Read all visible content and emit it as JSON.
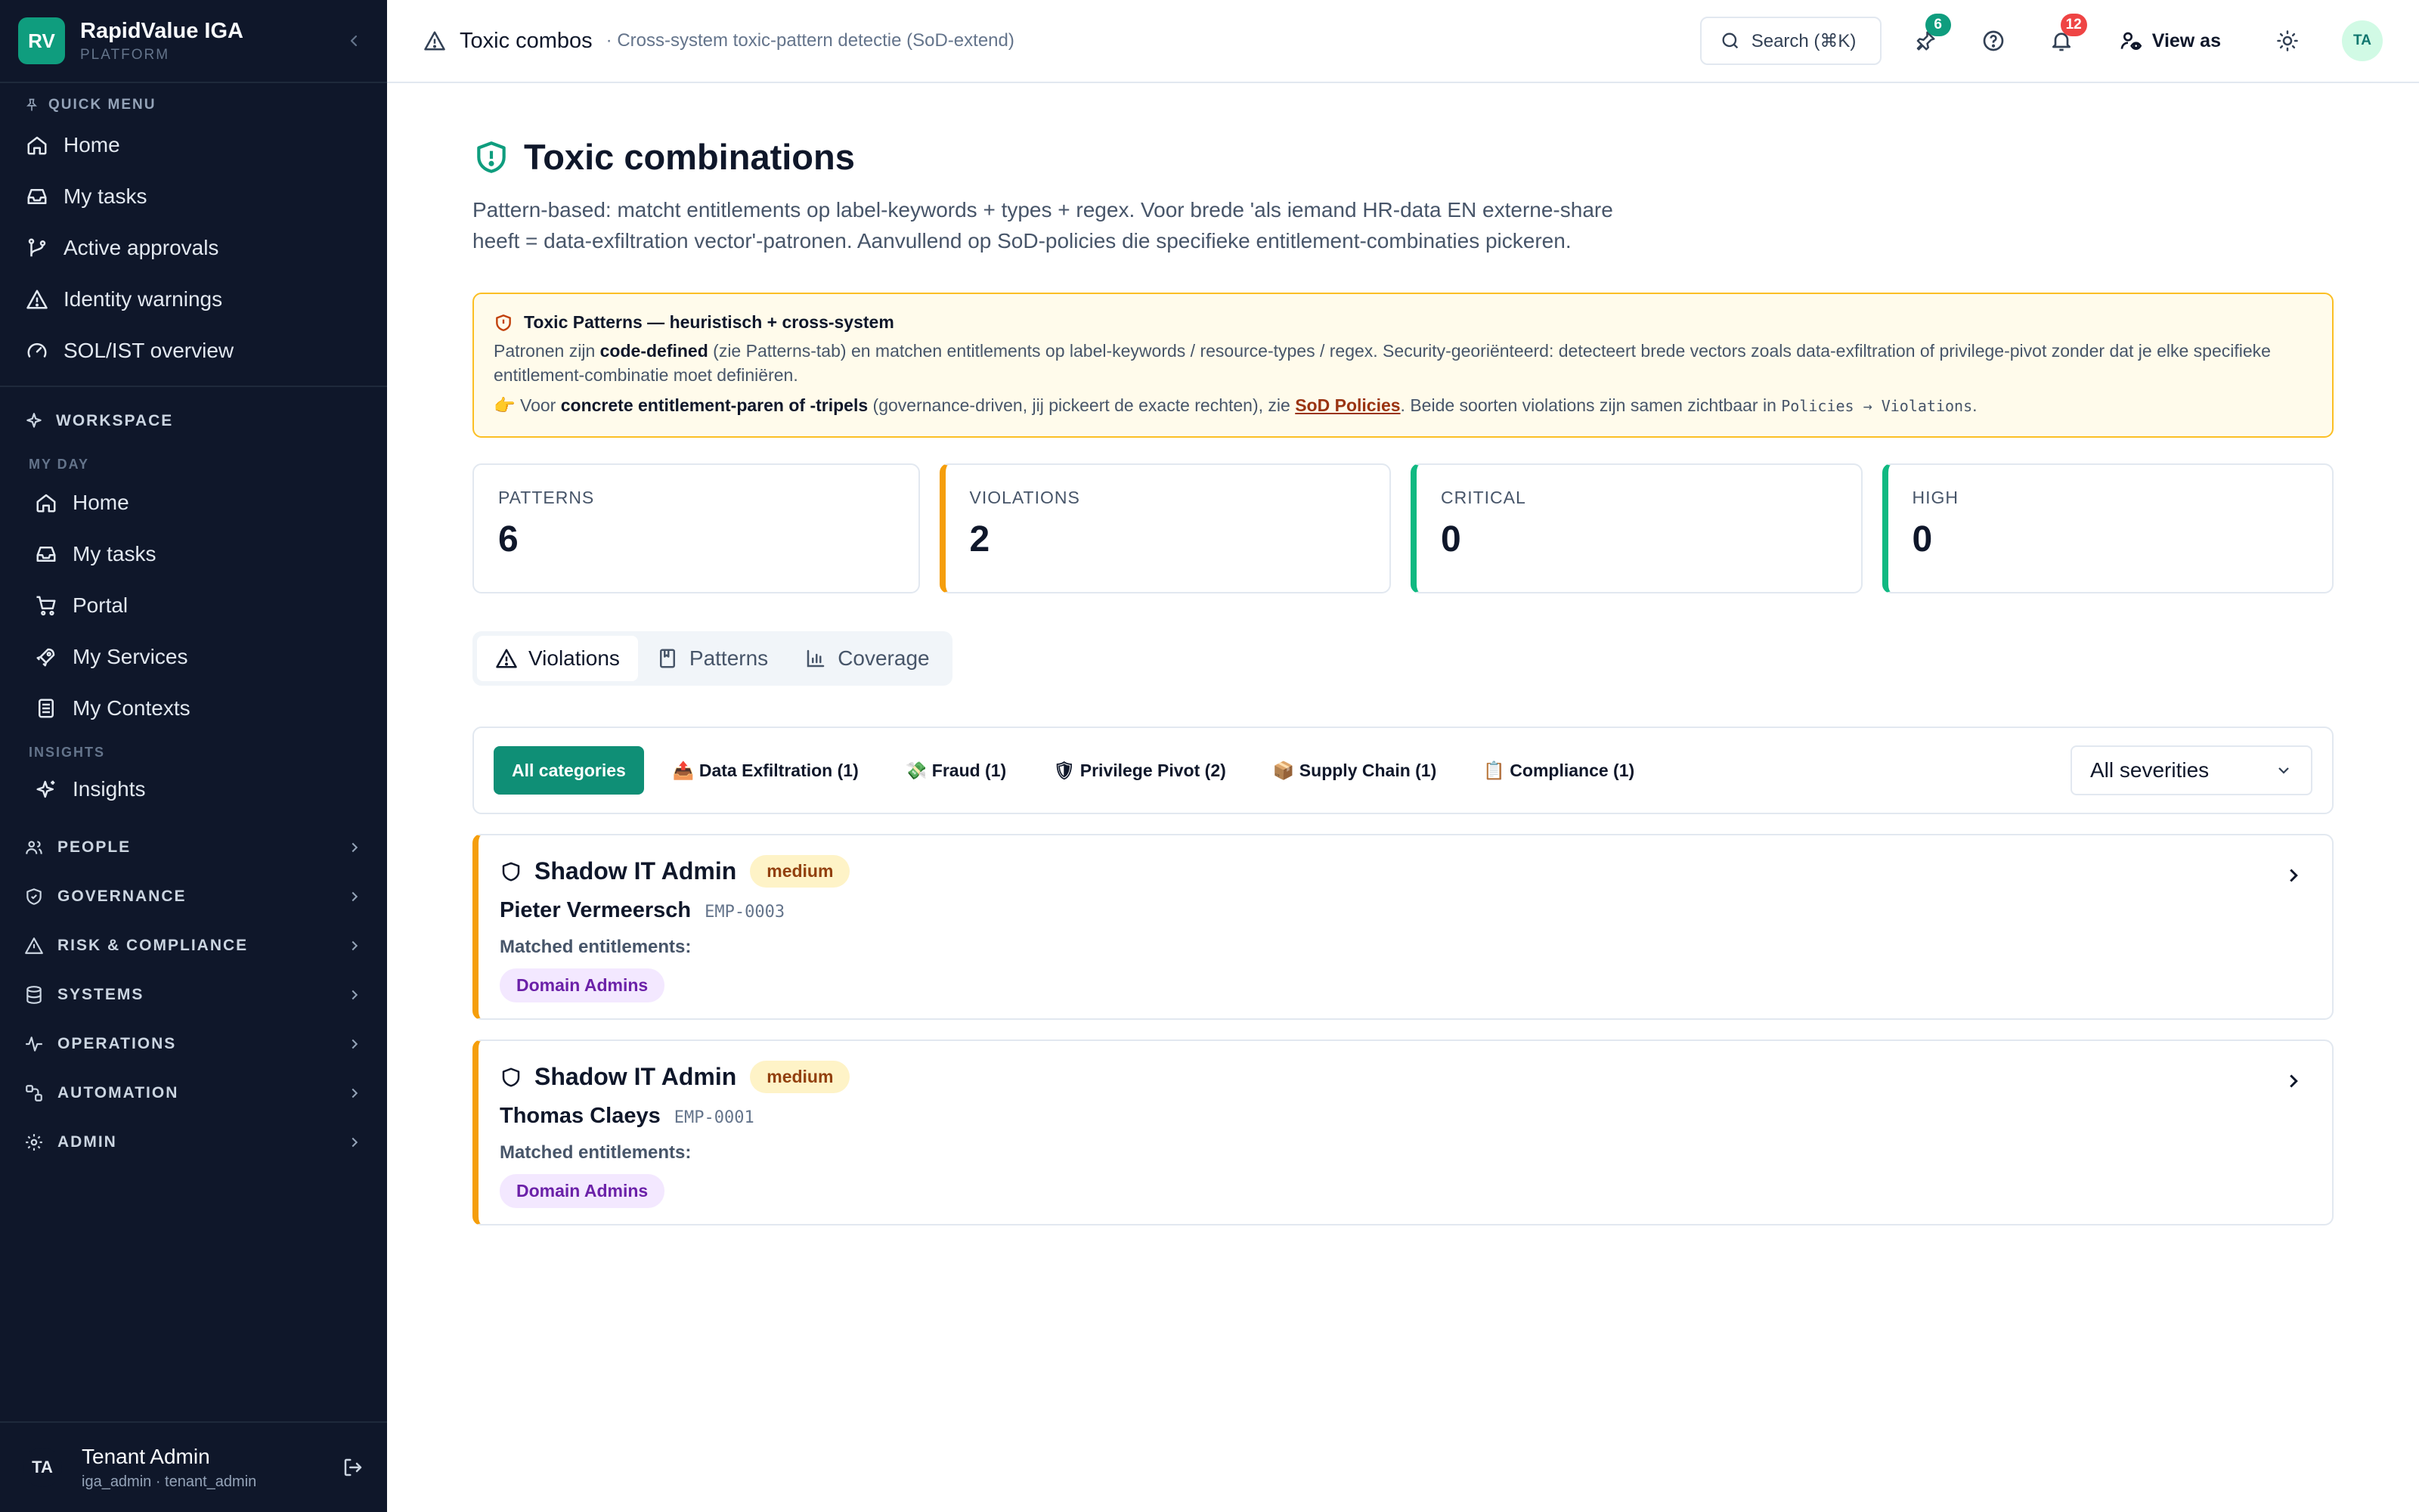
{
  "brand": {
    "logo": "RV",
    "name": "RapidValue IGA",
    "sub": "PLATFORM"
  },
  "sidebar": {
    "quick_menu_label": "QUICK MENU",
    "quick_menu": [
      {
        "label": "Home",
        "icon": "home-icon"
      },
      {
        "label": "My tasks",
        "icon": "inbox-icon"
      },
      {
        "label": "Active approvals",
        "icon": "branch-icon"
      },
      {
        "label": "Identity warnings",
        "icon": "warning-icon"
      },
      {
        "label": "SOL/IST overview",
        "icon": "gauge-icon"
      }
    ],
    "workspace_label": "WORKSPACE",
    "my_day_label": "MY DAY",
    "my_day": [
      {
        "label": "Home",
        "icon": "home-icon"
      },
      {
        "label": "My tasks",
        "icon": "inbox-icon"
      },
      {
        "label": "Portal",
        "icon": "cart-icon"
      },
      {
        "label": "My Services",
        "icon": "rocket-icon"
      },
      {
        "label": "My Contexts",
        "icon": "stack-icon"
      }
    ],
    "insights_label": "INSIGHTS",
    "insights": [
      {
        "label": "Insights",
        "icon": "sparkle-icon"
      }
    ],
    "groups": [
      {
        "label": "PEOPLE",
        "icon": "people-icon"
      },
      {
        "label": "GOVERNANCE",
        "icon": "shield-icon"
      },
      {
        "label": "RISK & COMPLIANCE",
        "icon": "warning-icon"
      },
      {
        "label": "SYSTEMS",
        "icon": "database-icon"
      },
      {
        "label": "OPERATIONS",
        "icon": "pulse-icon"
      },
      {
        "label": "AUTOMATION",
        "icon": "workflow-icon"
      },
      {
        "label": "ADMIN",
        "icon": "gear-icon"
      }
    ],
    "user": {
      "initials": "TA",
      "name": "Tenant Admin",
      "sub": "iga_admin · tenant_admin"
    }
  },
  "topbar": {
    "title": "Toxic combos",
    "subtitle": "· Cross-system toxic-pattern detectie (SoD-extend)",
    "search": "Search (⌘K)",
    "pins_badge": "6",
    "notif_badge": "12",
    "view_as": "View as",
    "avatar": "TA"
  },
  "page": {
    "title": "Toxic combinations",
    "description": "Pattern-based: matcht entitlements op label-keywords + types + regex. Voor brede 'als iemand HR-data EN externe-share heeft = data-exfiltration vector'-patronen. Aanvullend op SoD-policies die specifieke entitlement-combinaties pickeren."
  },
  "alert": {
    "title": "Toxic Patterns — heuristisch + cross-system",
    "p1_a": "Patronen zijn ",
    "p1_b": "code-defined",
    "p1_c": " (zie Patterns-tab) en matchen entitlements op label-keywords / resource-types / regex. Security-georiënteerd: detecteert brede vectors zoals data-exfiltration of privilege-pivot zonder dat je elke specifieke entitlement-combinatie moet definiëren.",
    "p2_a": "👉 Voor ",
    "p2_b": "concrete entitlement-paren of -tripels",
    "p2_c": " (governance-driven, jij pickeert de exacte rechten), zie ",
    "p2_link": "SoD Policies",
    "p2_d": ". Beide soorten violations zijn samen zichtbaar in ",
    "p2_code1": "Policies",
    "p2_arrow": " → ",
    "p2_code2": "Violations",
    "p2_end": "."
  },
  "stats": [
    {
      "label": "PATTERNS",
      "value": "6"
    },
    {
      "label": "VIOLATIONS",
      "value": "2"
    },
    {
      "label": "CRITICAL",
      "value": "0"
    },
    {
      "label": "HIGH",
      "value": "0"
    }
  ],
  "tabs": [
    {
      "label": "Violations",
      "icon": "warning-icon"
    },
    {
      "label": "Patterns",
      "icon": "book-icon"
    },
    {
      "label": "Coverage",
      "icon": "bar-chart-icon"
    }
  ],
  "filters": {
    "chips": [
      "All categories",
      "📤 Data Exfiltration (1)",
      "💸 Fraud (1)",
      "🛡 Privilege Pivot (2)",
      "📦 Supply Chain (1)",
      "📋 Compliance (1)"
    ],
    "severity": "All severities"
  },
  "violations": [
    {
      "name": "Shadow IT Admin",
      "severity": "medium",
      "person": "Pieter Vermeersch",
      "emp": "EMP-0003",
      "matched_label": "Matched entitlements:",
      "entitlement": "Domain Admins"
    },
    {
      "name": "Shadow IT Admin",
      "severity": "medium",
      "person": "Thomas Claeys",
      "emp": "EMP-0001",
      "matched_label": "Matched entitlements:",
      "entitlement": "Domain Admins"
    }
  ],
  "colors": {
    "accent": "#0f9d7e",
    "amber": "#f59e0b",
    "teal": "#10b981",
    "sidebar": "#0f172a"
  }
}
